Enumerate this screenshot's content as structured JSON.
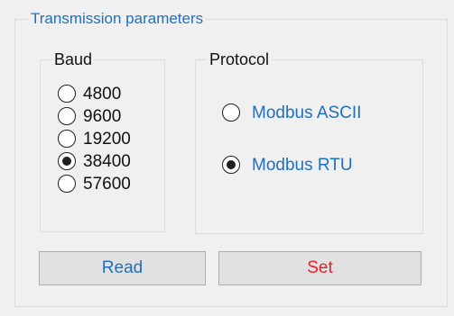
{
  "transmission": {
    "title": "Transmission parameters"
  },
  "baud": {
    "title": "Baud",
    "options": [
      {
        "label": "4800",
        "checked": false
      },
      {
        "label": "9600",
        "checked": false
      },
      {
        "label": "19200",
        "checked": false
      },
      {
        "label": "38400",
        "checked": true
      },
      {
        "label": "57600",
        "checked": false
      }
    ]
  },
  "protocol": {
    "title": "Protocol",
    "options": [
      {
        "label": "Modbus ASCII",
        "checked": false
      },
      {
        "label": "Modbus RTU",
        "checked": true
      }
    ]
  },
  "buttons": {
    "read_label": "Read",
    "set_label": "Set"
  },
  "colors": {
    "accent_blue": "#1e6fc0",
    "set_red": "#e8202a",
    "window_bg": "#f0f0f0"
  }
}
